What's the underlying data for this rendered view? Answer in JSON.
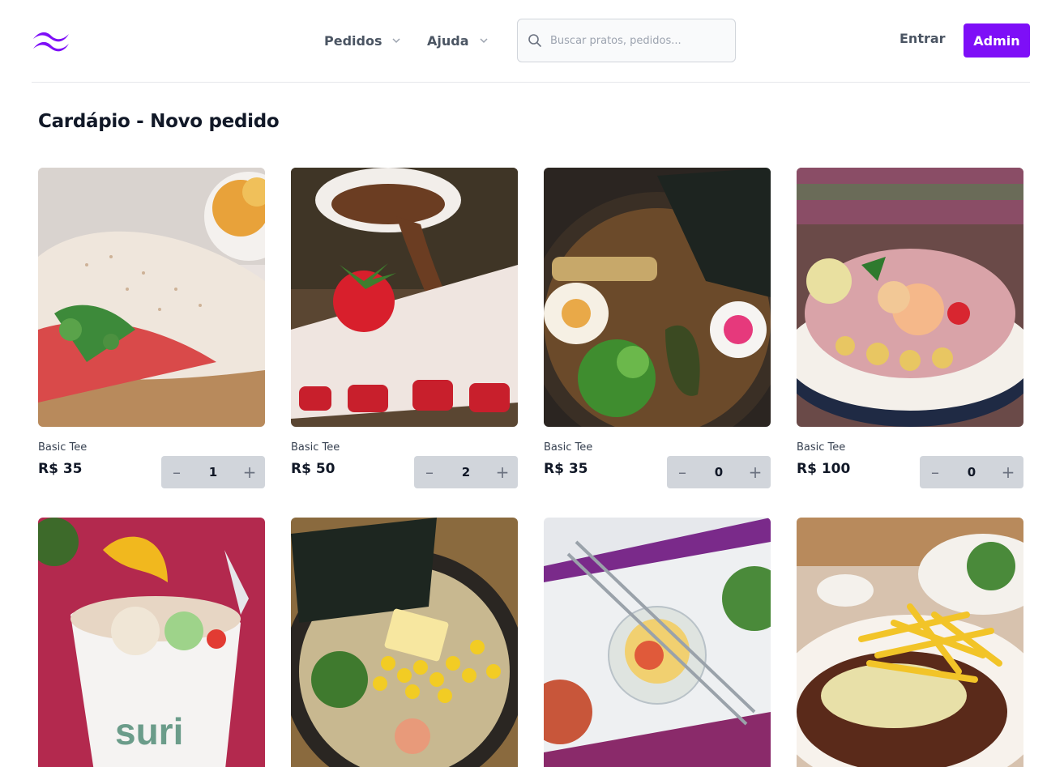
{
  "header": {
    "logo": "tailwind-wave-logo",
    "nav": [
      {
        "label": "Pedidos"
      },
      {
        "label": "Ajuda"
      }
    ],
    "search": {
      "placeholder": "Buscar pratos, pedidos...",
      "value": ""
    },
    "login_label": "Entrar",
    "admin_label": "Admin",
    "accent_color": "#7e0ff7"
  },
  "page": {
    "title": "Cardápio - Novo pedido"
  },
  "menu": {
    "items": [
      {
        "name": "Basic Tee",
        "price": "R$ 35",
        "quantity": "1",
        "image": "wrap-with-ham"
      },
      {
        "name": "Basic Tee",
        "price": "R$ 50",
        "quantity": "2",
        "image": "strawberry-chocolate-crepe"
      },
      {
        "name": "Basic Tee",
        "price": "R$ 35",
        "quantity": "0",
        "image": "ramen-bowl"
      },
      {
        "name": "Basic Tee",
        "price": "R$ 100",
        "quantity": "0",
        "image": "shrimp-ceviche"
      },
      {
        "image": "ceviche-cup"
      },
      {
        "image": "corn-butter-ramen"
      },
      {
        "image": "chopsticks-salad"
      },
      {
        "image": "steak-fries"
      }
    ]
  },
  "icons": {
    "search": "search-icon",
    "chevron": "chevron-down-icon",
    "minus": "minus-icon",
    "plus": "plus-icon"
  }
}
